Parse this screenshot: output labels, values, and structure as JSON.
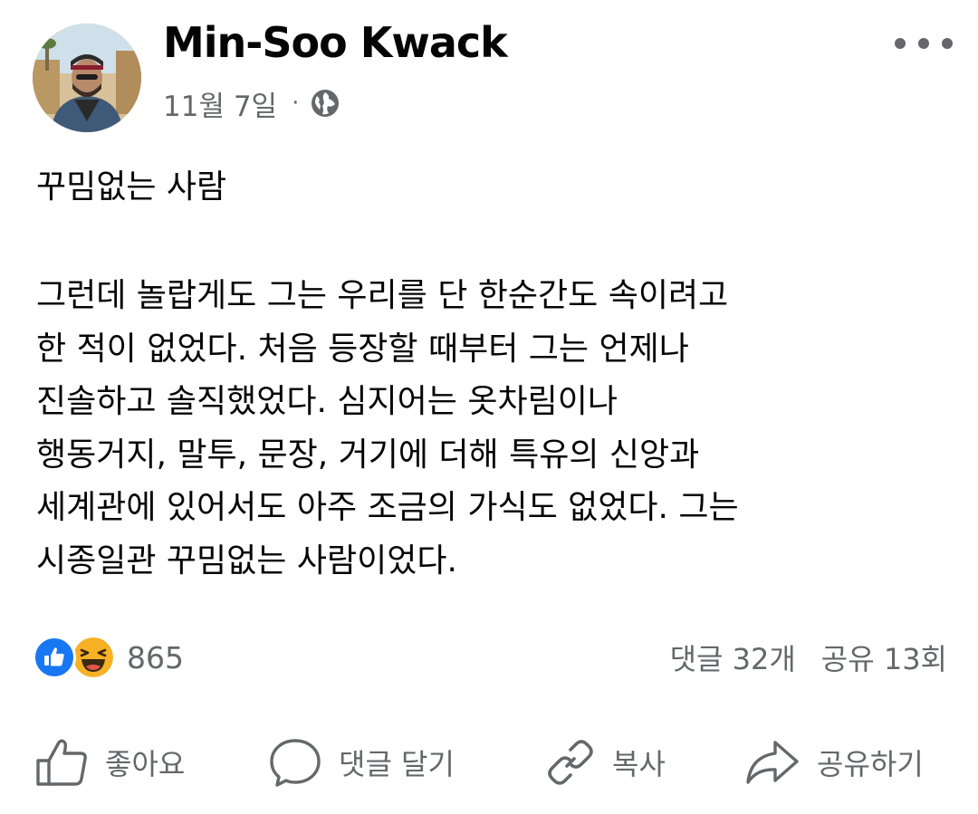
{
  "post": {
    "author": "Min-Soo Kwack",
    "date": "11월 7일",
    "separator": "·",
    "avatar_icon": "profile-photo",
    "privacy_icon": "globe-icon",
    "more_icon": "more-horizontal-icon",
    "title": "꾸밈없는 사람",
    "body_lines": [
      "그런데 놀랍게도 그는 우리를 단 한순간도 속이려고",
      "한 적이 없었다. 처음 등장할 때부터 그는 언제나",
      "진솔하고 솔직했었다. 심지어는 옷차림이나",
      "행동거지, 말투, 문장, 거기에 더해 특유의 신앙과",
      "세계관에 있어서도 아주 조금의 가식도 없었다. 그는",
      "시종일관 꾸밈없는 사람이었다."
    ]
  },
  "stats": {
    "reaction_icons": [
      "like-reaction-icon",
      "haha-reaction-icon"
    ],
    "reaction_count": "865",
    "comments": "댓글 32개",
    "shares": "공유 13회"
  },
  "actions": {
    "like": "좋아요",
    "comment": "댓글 달기",
    "copy": "복사",
    "share": "공유하기"
  },
  "colors": {
    "text": "#050505",
    "secondary": "#65676b",
    "like_blue": "#1877f2",
    "haha_yellow": "#f7b125"
  }
}
